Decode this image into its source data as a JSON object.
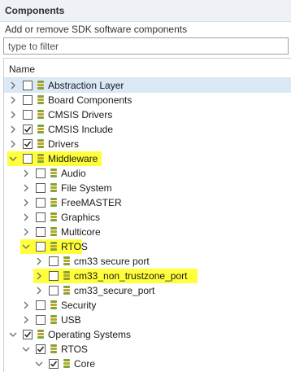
{
  "header": {
    "title": "Components"
  },
  "subtitle": "Add or remove SDK software components",
  "filter": {
    "placeholder": "type to filter"
  },
  "tree": {
    "column_header": "Name",
    "rows": [
      {
        "label": "Abstraction Layer",
        "level": 0,
        "expanded": false,
        "checked": false,
        "selected": true
      },
      {
        "label": "Board Components",
        "level": 0,
        "expanded": false,
        "checked": false
      },
      {
        "label": "CMSIS Drivers",
        "level": 0,
        "expanded": false,
        "checked": false
      },
      {
        "label": "CMSIS Include",
        "level": 0,
        "expanded": false,
        "checked": true
      },
      {
        "label": "Drivers",
        "level": 0,
        "expanded": false,
        "checked": true
      },
      {
        "label": "Middleware",
        "level": 0,
        "expanded": true,
        "checked": false,
        "highlighted": true
      },
      {
        "label": "Audio",
        "level": 1,
        "expanded": false,
        "checked": false
      },
      {
        "label": "File System",
        "level": 1,
        "expanded": false,
        "checked": false
      },
      {
        "label": "FreeMASTER",
        "level": 1,
        "expanded": false,
        "checked": false
      },
      {
        "label": "Graphics",
        "level": 1,
        "expanded": false,
        "checked": false
      },
      {
        "label": "Multicore",
        "level": 1,
        "expanded": false,
        "checked": false
      },
      {
        "label": "RTOS",
        "level": 1,
        "expanded": true,
        "checked": false,
        "highlighted": true
      },
      {
        "label": "cm33 secure port",
        "level": 2,
        "expanded": false,
        "checked": false
      },
      {
        "label": "cm33_non_trustzone_port",
        "level": 2,
        "expanded": false,
        "checked": false,
        "highlighted": true
      },
      {
        "label": "cm33_secure_port",
        "level": 2,
        "expanded": false,
        "checked": false
      },
      {
        "label": "Security",
        "level": 1,
        "expanded": false,
        "checked": false
      },
      {
        "label": "USB",
        "level": 1,
        "expanded": false,
        "checked": false
      },
      {
        "label": "Operating Systems",
        "level": 0,
        "expanded": true,
        "checked": true
      },
      {
        "label": "RTOS",
        "level": 1,
        "expanded": true,
        "checked": true
      },
      {
        "label": "Core",
        "level": 2,
        "expanded": true,
        "checked": true
      }
    ]
  },
  "colors": {
    "highlight": "#ffff19",
    "selected_row": "#dbe9f7",
    "header_bg": "#eef2f7",
    "package_green": "#7ea63a",
    "package_gold": "#c9a227"
  },
  "icons": {
    "collapsed": "chevron-right-icon",
    "expanded": "chevron-down-icon",
    "package": "package-icon",
    "check": "checkmark-icon"
  }
}
